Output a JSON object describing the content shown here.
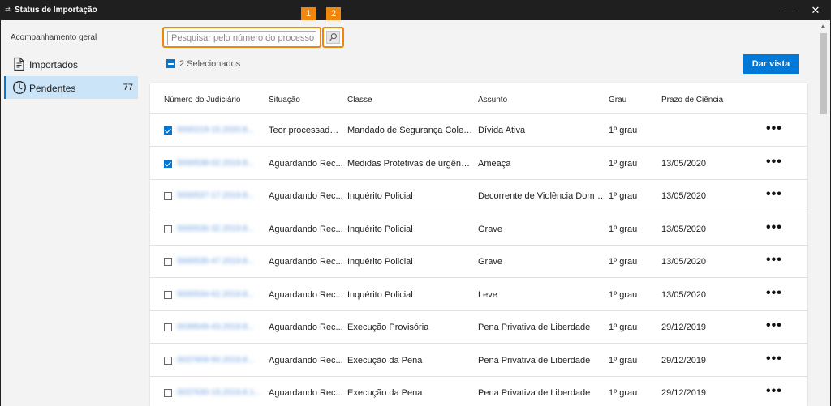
{
  "window": {
    "title": "Status de Importação",
    "minimize": "—",
    "close": "✕"
  },
  "sidebar": {
    "heading": "Acompanhamento geral",
    "items": [
      {
        "label": "Importados",
        "icon": "document-icon",
        "active": false
      },
      {
        "label": "Pendentes",
        "icon": "clock-icon",
        "active": true,
        "count": "77"
      }
    ]
  },
  "toolbar": {
    "search_placeholder": "Pesquisar pelo número do processo",
    "badge_1": "1",
    "badge_2": "2",
    "selected_label": "2 Selecionados",
    "dar_vista": "Dar vista"
  },
  "table": {
    "columns": [
      "Número do Judiciário",
      "Situação",
      "Classe",
      "Assunto",
      "Grau",
      "Prazo de Ciência"
    ],
    "rows": [
      {
        "checked": true,
        "numero": "5000219-15.2020.8...",
        "situacao": "Teor processado ...",
        "classe": "Mandado de Segurança Coleti...",
        "assunto": "Dívida Ativa",
        "grau": "1º grau",
        "prazo": ""
      },
      {
        "checked": true,
        "numero": "5000538-02.2019.8...",
        "situacao": "Aguardando Rec...",
        "classe": "Medidas Protetivas de urgênci...",
        "assunto": "Ameaça",
        "grau": "1º grau",
        "prazo": "13/05/2020"
      },
      {
        "checked": false,
        "numero": "5000537-17.2019.8...",
        "situacao": "Aguardando Rec...",
        "classe": "Inquérito Policial",
        "assunto": "Decorrente de Violência Domé...",
        "grau": "1º grau",
        "prazo": "13/05/2020"
      },
      {
        "checked": false,
        "numero": "5000536-32.2019.8...",
        "situacao": "Aguardando Rec...",
        "classe": "Inquérito Policial",
        "assunto": "Grave",
        "grau": "1º grau",
        "prazo": "13/05/2020"
      },
      {
        "checked": false,
        "numero": "5000535-47.2019.8...",
        "situacao": "Aguardando Rec...",
        "classe": "Inquérito Policial",
        "assunto": "Grave",
        "grau": "1º grau",
        "prazo": "13/05/2020"
      },
      {
        "checked": false,
        "numero": "5000534-62.2019.8...",
        "situacao": "Aguardando Rec...",
        "classe": "Inquérito Policial",
        "assunto": "Leve",
        "grau": "1º grau",
        "prazo": "13/05/2020"
      },
      {
        "checked": false,
        "numero": "0039549-43.2019.8...",
        "situacao": "Aguardando Rec...",
        "classe": "Execução Provisória",
        "assunto": "Pena Privativa de Liberdade",
        "grau": "1º grau",
        "prazo": "29/12/2019"
      },
      {
        "checked": false,
        "numero": "0037609-50.2019.8...",
        "situacao": "Aguardando Rec...",
        "classe": "Execução da Pena",
        "assunto": "Pena Privativa de Liberdade",
        "grau": "1º grau",
        "prazo": "29/12/2019"
      },
      {
        "checked": false,
        "numero": "0037630-19.2019.8.1...",
        "situacao": "Aguardando Rec...",
        "classe": "Execução da Pena",
        "assunto": "Pena Privativa de Liberdade",
        "grau": "1º grau",
        "prazo": "29/12/2019"
      }
    ],
    "more_label": "•••"
  },
  "colors": {
    "accent": "#0078d7",
    "highlight": "#f0860c",
    "titlebar": "#1f1f1f",
    "active_item": "#cce4f7"
  }
}
